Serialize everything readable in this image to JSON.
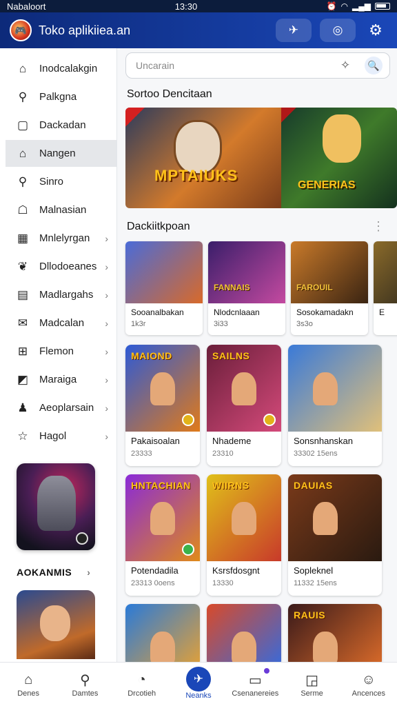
{
  "status": {
    "carrier": "Nabaloort",
    "time": "13:30"
  },
  "app": {
    "title": "Toko aplikiiea.an"
  },
  "search": {
    "placeholder": "Uncarain"
  },
  "sidebar": {
    "items": [
      {
        "label": "Inodcalakgin",
        "icon": "home-outline-icon",
        "chevron": false
      },
      {
        "label": "Palkgna",
        "icon": "search-icon",
        "chevron": false
      },
      {
        "label": "Dackadan",
        "icon": "square-icon",
        "chevron": false
      },
      {
        "label": "Nangen",
        "icon": "folder-icon",
        "chevron": false,
        "active": true
      },
      {
        "label": "Sinro",
        "icon": "search-icon",
        "chevron": false
      },
      {
        "label": "Malnasian",
        "icon": "puzzle-icon",
        "chevron": false
      },
      {
        "label": "Mnlelyrgan",
        "icon": "calculator-icon",
        "chevron": true
      },
      {
        "label": "Dllodoeanes",
        "icon": "leaf-icon",
        "chevron": true
      },
      {
        "label": "Madlargahs",
        "icon": "window-icon",
        "chevron": true
      },
      {
        "label": "Madcalan",
        "icon": "mail-icon",
        "chevron": true
      },
      {
        "label": "Flemon",
        "icon": "grid-icon",
        "chevron": true
      },
      {
        "label": "Maraiga",
        "icon": "edit-box-icon",
        "chevron": true
      },
      {
        "label": "Aeoplarsain",
        "icon": "pawn-icon",
        "chevron": true
      },
      {
        "label": "Hagol",
        "icon": "star-outline-icon",
        "chevron": true
      }
    ],
    "section_label": "AOKANMIS"
  },
  "main": {
    "banner_section": "Sortoo Dencitaan",
    "banner": {
      "left_text": "MPTAIUKS",
      "right_text": "GENERIAS"
    },
    "wide_section": "Dackiitkpoan",
    "wide_cards": [
      {
        "name": "Sooanalbakan",
        "meta": "1k3r",
        "art_text": "",
        "colors": [
          "#4a6bd8",
          "#d86a2a"
        ]
      },
      {
        "name": "Nlodcnlaaan",
        "meta": "3i33",
        "art_text": "FANNAIS",
        "colors": [
          "#3a1e6a",
          "#c44aa0"
        ]
      },
      {
        "name": "Sosokamadakn",
        "meta": "3s3o",
        "art_text": "FAROUIL",
        "colors": [
          "#c97a2a",
          "#3a2412"
        ]
      },
      {
        "name": "E",
        "meta": "",
        "art_text": "",
        "colors": [
          "#8a6a2a",
          "#1a1a1a"
        ]
      }
    ],
    "grid_cards": [
      {
        "name": "Pakaisoalan",
        "meta": "23333",
        "art_title": "MAIOND",
        "badge": "gold",
        "colors": [
          "#2d5ad6",
          "#e07a1a"
        ]
      },
      {
        "name": "Nhademe",
        "meta": "23310",
        "art_title": "SAILNS",
        "badge": "gold",
        "colors": [
          "#6a1e3a",
          "#d44a7a"
        ]
      },
      {
        "name": "Sonsnhanskan",
        "meta": "33302 15ens",
        "art_title": "",
        "badge": "",
        "colors": [
          "#3a7ad8",
          "#e0c07a"
        ]
      },
      {
        "name": "Potendadila",
        "meta": "23313 0oens",
        "art_title": "HNTACHIAN",
        "badge": "green",
        "colors": [
          "#8a2ad8",
          "#e08a1a"
        ]
      },
      {
        "name": "Ksrsfdosgnt",
        "meta": "13330",
        "art_title": "WIIRNS",
        "badge": "",
        "colors": [
          "#e0c01a",
          "#c83a2a"
        ]
      },
      {
        "name": "Sopleknel",
        "meta": "11332 15ens",
        "art_title": "DAUIAS",
        "badge": "",
        "colors": [
          "#7a3a1a",
          "#2a1a10"
        ]
      },
      {
        "name": "",
        "meta": "",
        "art_title": "",
        "badge": "",
        "colors": [
          "#2a7ad8",
          "#e0a03a"
        ]
      },
      {
        "name": "",
        "meta": "",
        "art_title": "",
        "badge": "",
        "colors": [
          "#d84a2a",
          "#3a6ad8"
        ]
      },
      {
        "name": "",
        "meta": "",
        "art_title": "RAUIS",
        "badge": "",
        "colors": [
          "#3a1a1a",
          "#d86a2a"
        ]
      }
    ]
  },
  "bottom_nav": [
    {
      "label": "Denes",
      "icon": "home-icon"
    },
    {
      "label": "Damtes",
      "icon": "search-icon"
    },
    {
      "label": "Drcotieh",
      "icon": "compass-icon"
    },
    {
      "label": "Neanks",
      "icon": "plane-icon",
      "active": true
    },
    {
      "label": "Csenanereies",
      "icon": "inbox-icon",
      "dot": true
    },
    {
      "label": "Serme",
      "icon": "chat-icon"
    },
    {
      "label": "Ancences",
      "icon": "person-icon"
    }
  ]
}
